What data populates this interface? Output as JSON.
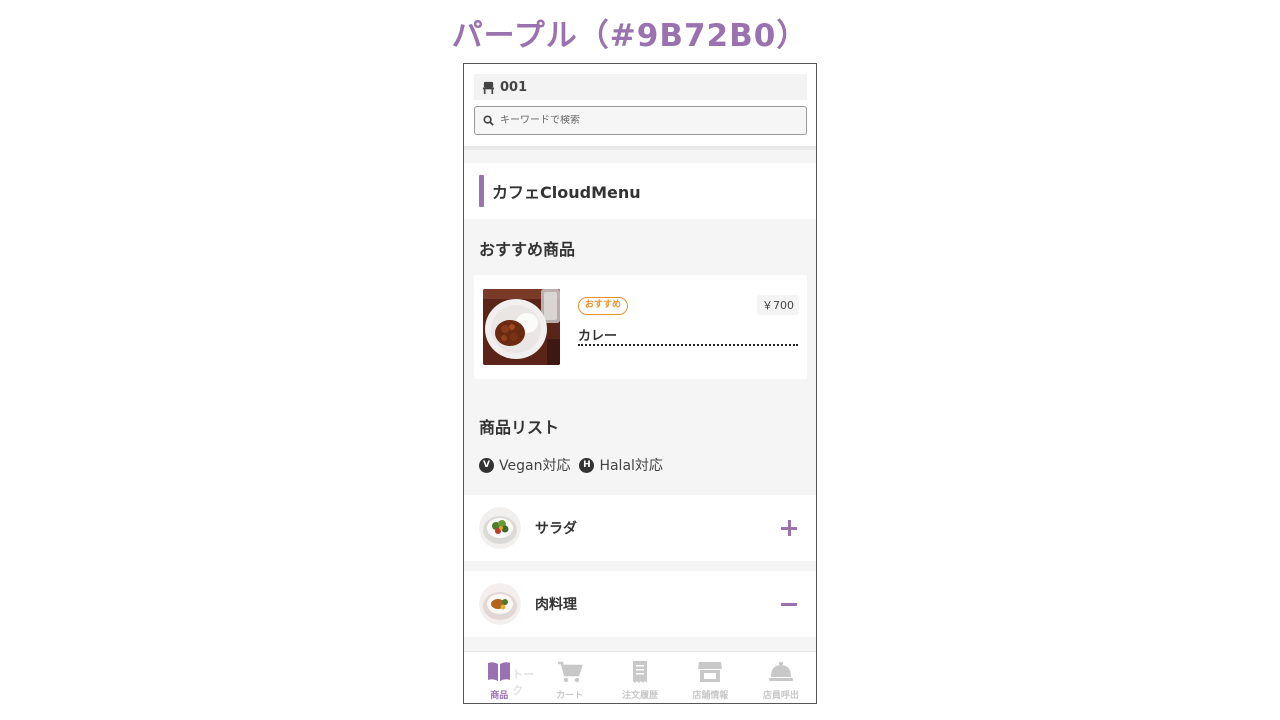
{
  "slide": {
    "title": "パープル（#9B72B0）"
  },
  "theme": {
    "accent": "#9B72B0",
    "badge_color": "#E8922E"
  },
  "header": {
    "table_number": "001",
    "table_icon": "chair-icon",
    "search_placeholder": "キーワードで検索",
    "search_icon": "search-icon"
  },
  "shop": {
    "name": "カフェCloudMenu"
  },
  "recommended": {
    "section_title": "おすすめ商品",
    "items": [
      {
        "badge": "おすすめ",
        "name": "カレー",
        "price": "￥700"
      }
    ]
  },
  "product_list": {
    "section_title": "商品リスト",
    "legend": [
      {
        "mark": "V",
        "label": "Vegan対応"
      },
      {
        "mark": "H",
        "label": "Halal対応"
      }
    ],
    "categories": [
      {
        "label": "サラダ",
        "state": "collapsed",
        "toggle_icon": "plus-icon"
      },
      {
        "label": "肉料理",
        "state": "expanded",
        "toggle_icon": "minus-icon"
      }
    ]
  },
  "bottom_nav": {
    "items": [
      {
        "label": "商品",
        "icon": "book-icon",
        "active": true
      },
      {
        "label": "カート",
        "icon": "cart-icon",
        "active": false
      },
      {
        "label": "注文履歴",
        "icon": "receipt-icon",
        "active": false
      },
      {
        "label": "店舗情報",
        "icon": "store-icon",
        "active": false
      },
      {
        "label": "店員呼出",
        "icon": "bell-icon",
        "active": false
      }
    ],
    "overlay_text": "トーク"
  }
}
